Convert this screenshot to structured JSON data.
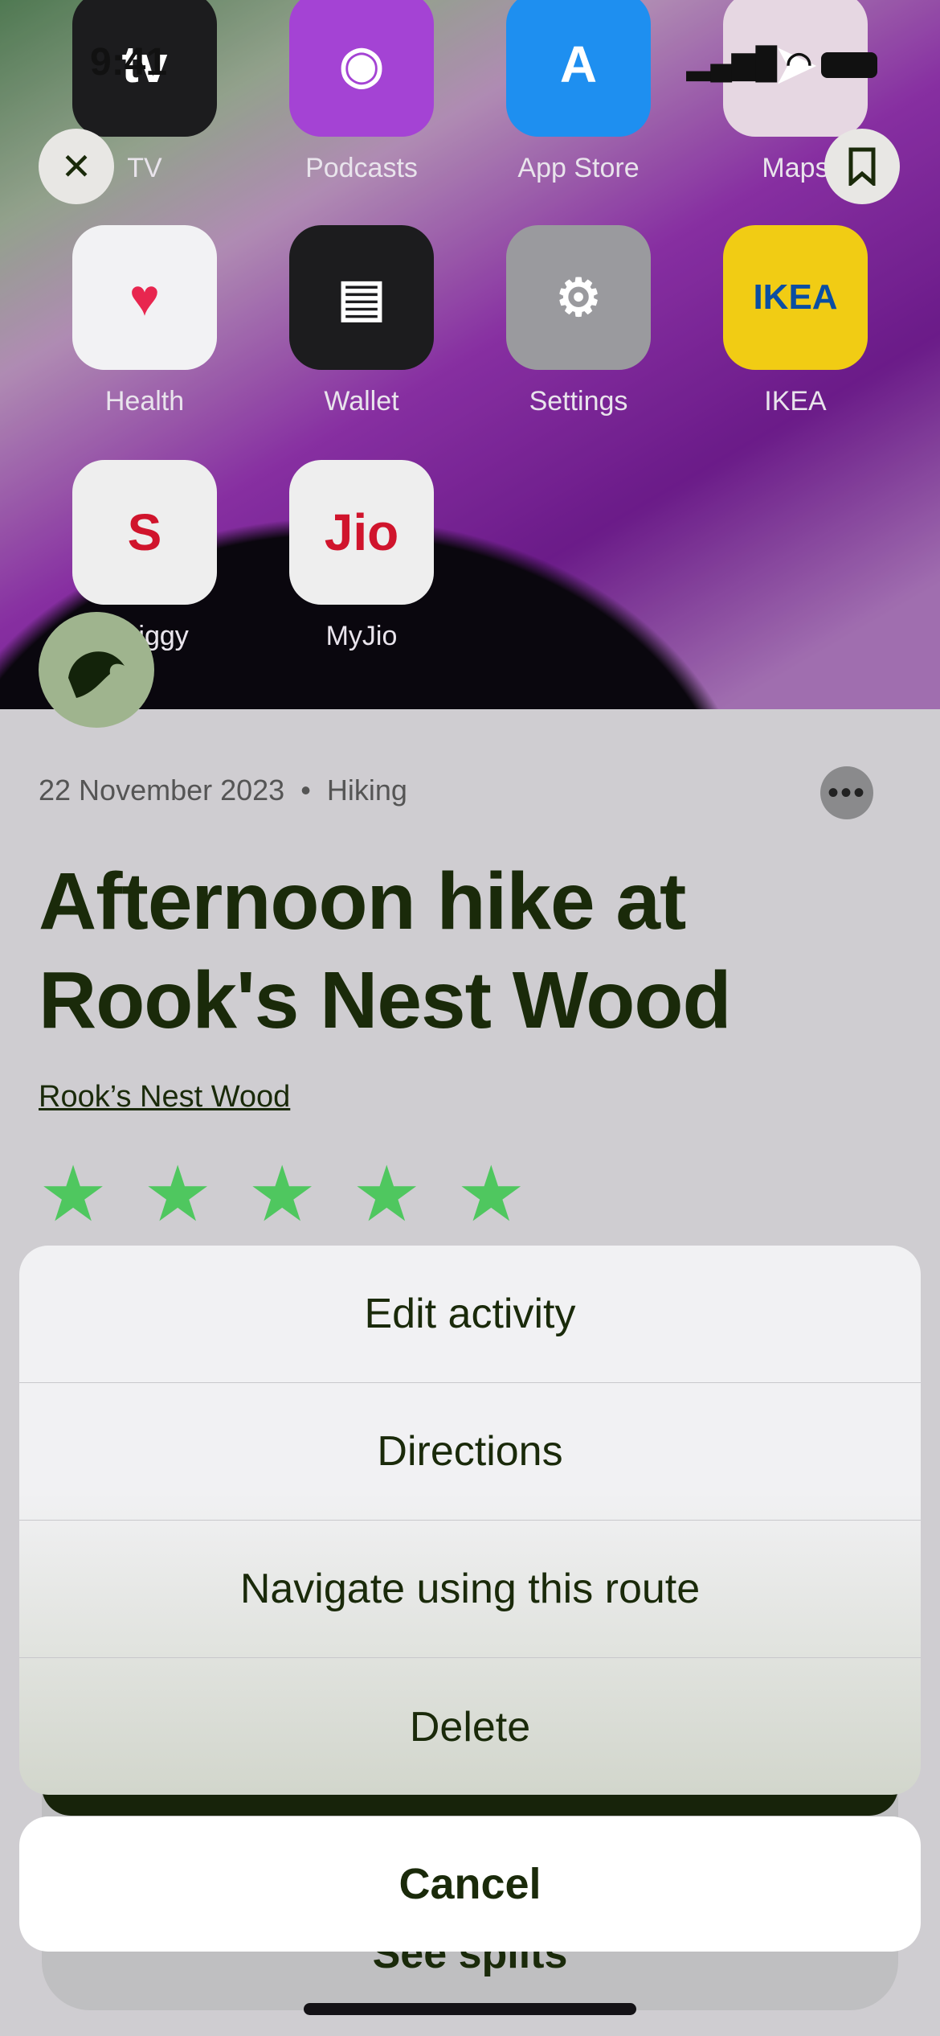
{
  "status_bar": {
    "time": "9:41"
  },
  "home_screen": {
    "apps": [
      {
        "name": "TV",
        "glyph": "tv",
        "color": "#1c1c1e"
      },
      {
        "name": "Podcasts",
        "glyph": "◉",
        "color": "#a443d4"
      },
      {
        "name": "App Store",
        "glyph": "A",
        "color": "#1e8ff0"
      },
      {
        "name": "Maps",
        "glyph": "➤",
        "color": "#e6d7e2"
      },
      {
        "name": "Health",
        "glyph": "♥",
        "color": "#f2f2f4"
      },
      {
        "name": "Wallet",
        "glyph": "▤",
        "color": "#1c1c1e"
      },
      {
        "name": "Settings",
        "glyph": "⚙",
        "color": "#9a9a9e"
      },
      {
        "name": "IKEA",
        "glyph": "IKEA",
        "color": "#f1cc14"
      },
      {
        "name": "Swiggy",
        "glyph": "S",
        "color": "#eee"
      },
      {
        "name": "MyJio",
        "glyph": "Jio",
        "color": "#eee"
      }
    ],
    "partial_label": "ggy"
  },
  "activity": {
    "date": "22 November 2023",
    "separator": "•",
    "type": "Hiking",
    "title": "Afternoon hike at Rook's Nest Wood",
    "location": "Rook’s Nest Wood",
    "rating": 5,
    "rating_max": 5,
    "star_color": "#4fc75f"
  },
  "behind": {
    "see_splits": "See splits"
  },
  "action_sheet": {
    "items": [
      "Edit activity",
      "Directions",
      "Navigate using this route",
      "Delete"
    ],
    "cancel": "Cancel"
  }
}
